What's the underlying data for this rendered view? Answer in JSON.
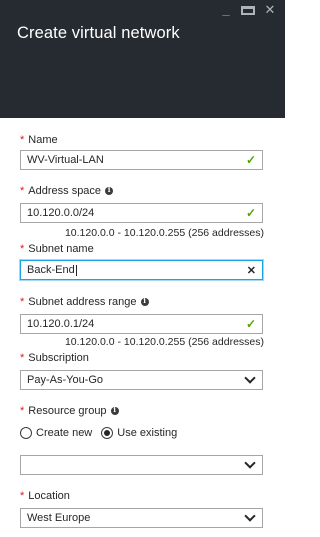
{
  "window": {
    "title": "Create virtual network",
    "minimize_glyph": "_",
    "close_glyph": "✕"
  },
  "form": {
    "name": {
      "label": "Name",
      "value": "WV-Virtual-LAN",
      "required": "*"
    },
    "address_space": {
      "label": "Address space",
      "value": "10.120.0.0/24",
      "hint": "10.120.0.0 - 10.120.0.255 (256 addresses)",
      "required": "*"
    },
    "subnet_name": {
      "label": "Subnet name",
      "value": "Back-End",
      "required": "*",
      "clear_glyph": "✕"
    },
    "subnet_range": {
      "label": "Subnet address range",
      "value": "10.120.0.1/24",
      "hint": "10.120.0.0 - 10.120.0.255 (256 addresses)",
      "required": "*"
    },
    "subscription": {
      "label": "Subscription",
      "value": "Pay-As-You-Go",
      "required": "*"
    },
    "resource_group": {
      "label": "Resource group",
      "required": "*",
      "options": [
        "Create new",
        "Use existing"
      ],
      "selected": "Use existing",
      "value": ""
    },
    "location": {
      "label": "Location",
      "value": "West Europe",
      "required": "*"
    }
  },
  "icons": {
    "valid": "check-icon",
    "info": "info-icon",
    "dropdown": "chevron-down-icon"
  },
  "colors": {
    "header_bg": "#252b30",
    "required": "#e81123",
    "valid_check": "#57a300",
    "focus_border": "#1aa3e6"
  }
}
